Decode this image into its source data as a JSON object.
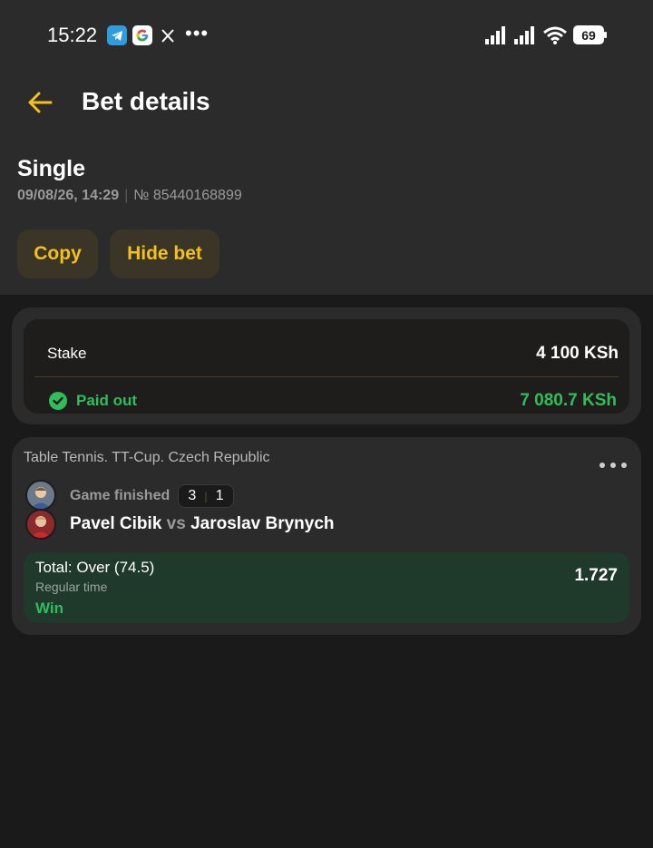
{
  "status_bar": {
    "time": "15:22",
    "battery": "69",
    "app_icons": [
      "telegram-icon",
      "google-icon",
      "x-icon"
    ],
    "overflow": "•••"
  },
  "header": {
    "title": "Bet details",
    "back_icon": "arrow-left-icon"
  },
  "bet": {
    "type": "Single",
    "date": "09/08/26, 14:29",
    "number": "№ 85440168899"
  },
  "actions": {
    "copy_label": "Copy",
    "hide_label": "Hide bet"
  },
  "stake": {
    "label": "Stake",
    "value": "4 100 KSh",
    "paid_label": "Paid out",
    "paid_value": "7 080.7 KSh"
  },
  "event": {
    "league": "Table Tennis. TT-Cup. Czech Republic",
    "status": "Game finished",
    "score_home": "3",
    "score_away": "1",
    "home": "Pavel Cibik",
    "vs": "vs",
    "away": "Jaroslav Brynych"
  },
  "selection": {
    "market": "Total: Over (74.5)",
    "period": "Regular time",
    "result": "Win",
    "odds": "1.727"
  },
  "colors": {
    "accent": "#f4c01b",
    "win": "#2fbe5a",
    "background": "#1a1a1a",
    "card": "#2b2b2b",
    "selection_bg": "#1f3a2a"
  }
}
